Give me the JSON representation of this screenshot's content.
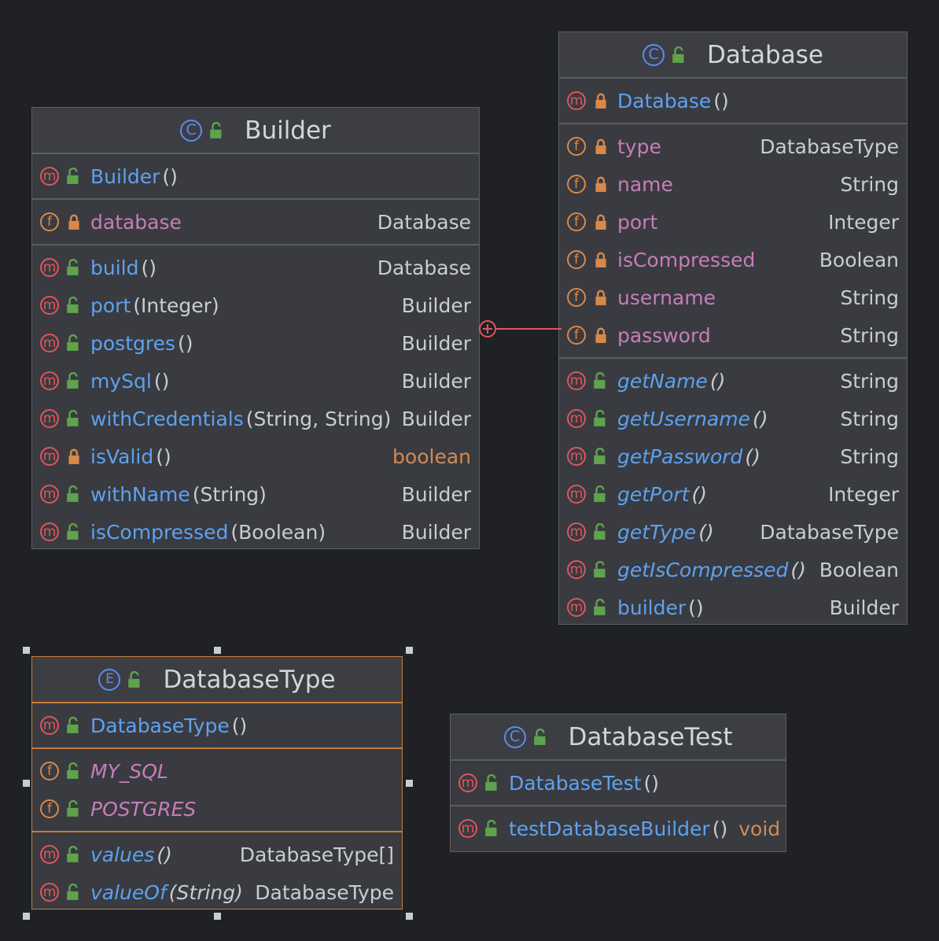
{
  "classes": {
    "builder": {
      "name": "Builder",
      "ctor": {
        "name": "Builder",
        "params": "()"
      },
      "field": {
        "name": "database",
        "type": "Database"
      },
      "methods": [
        {
          "name": "build",
          "params": "()",
          "type": "Database"
        },
        {
          "name": "port",
          "params": "(Integer)",
          "type": "Builder"
        },
        {
          "name": "postgres",
          "params": "()",
          "type": "Builder"
        },
        {
          "name": "mySql",
          "params": "()",
          "type": "Builder"
        },
        {
          "name": "withCredentials",
          "params": "(String, String)",
          "type": "Builder"
        },
        {
          "name": "isValid",
          "params": "()",
          "type": "boolean"
        },
        {
          "name": "withName",
          "params": "(String)",
          "type": "Builder"
        },
        {
          "name": "isCompressed",
          "params": "(Boolean)",
          "type": "Builder"
        }
      ]
    },
    "database": {
      "name": "Database",
      "ctor": {
        "name": "Database",
        "params": "()"
      },
      "fields": [
        {
          "name": "type",
          "type": "DatabaseType"
        },
        {
          "name": "name",
          "type": "String"
        },
        {
          "name": "port",
          "type": "Integer"
        },
        {
          "name": "isCompressed",
          "type": "Boolean"
        },
        {
          "name": "username",
          "type": "String"
        },
        {
          "name": "password",
          "type": "String"
        }
      ],
      "methods": [
        {
          "name": "getName",
          "params": "()",
          "type": "String"
        },
        {
          "name": "getUsername",
          "params": "()",
          "type": "String"
        },
        {
          "name": "getPassword",
          "params": "()",
          "type": "String"
        },
        {
          "name": "getPort",
          "params": "()",
          "type": "Integer"
        },
        {
          "name": "getType",
          "params": "()",
          "type": "DatabaseType"
        },
        {
          "name": "getIsCompressed",
          "params": "()",
          "type": "Boolean"
        },
        {
          "name": "builder",
          "params": "()",
          "type": "Builder"
        }
      ]
    },
    "database_type": {
      "name": "DatabaseType",
      "ctor": {
        "name": "DatabaseType",
        "params": "()"
      },
      "constants": [
        {
          "name": "MY_SQL"
        },
        {
          "name": "POSTGRES"
        }
      ],
      "methods": [
        {
          "name": "values",
          "params": "()",
          "type": "DatabaseType[]"
        },
        {
          "name": "valueOf",
          "params": "(String)",
          "type": "DatabaseType"
        }
      ]
    },
    "database_test": {
      "name": "DatabaseTest",
      "ctor": {
        "name": "DatabaseTest",
        "params": "()"
      },
      "methods": [
        {
          "name": "testDatabaseBuilder",
          "params": "()",
          "type": "void"
        }
      ]
    }
  },
  "icons": {
    "class_kind": "C",
    "enum_kind": "E",
    "method_kind": "m",
    "field_kind": "f"
  },
  "colors": {
    "background": "#1f2125",
    "method_icon": "#e0555d",
    "field_icon": "#d8894a",
    "class_icon": "#5b8bf0",
    "public_green": "#5fa34c",
    "private_orange": "#d8894a",
    "method_name": "#5ea1f0",
    "field_name": "#c77dba",
    "selection_border": "#c77c37",
    "connector": "#e0555d"
  }
}
